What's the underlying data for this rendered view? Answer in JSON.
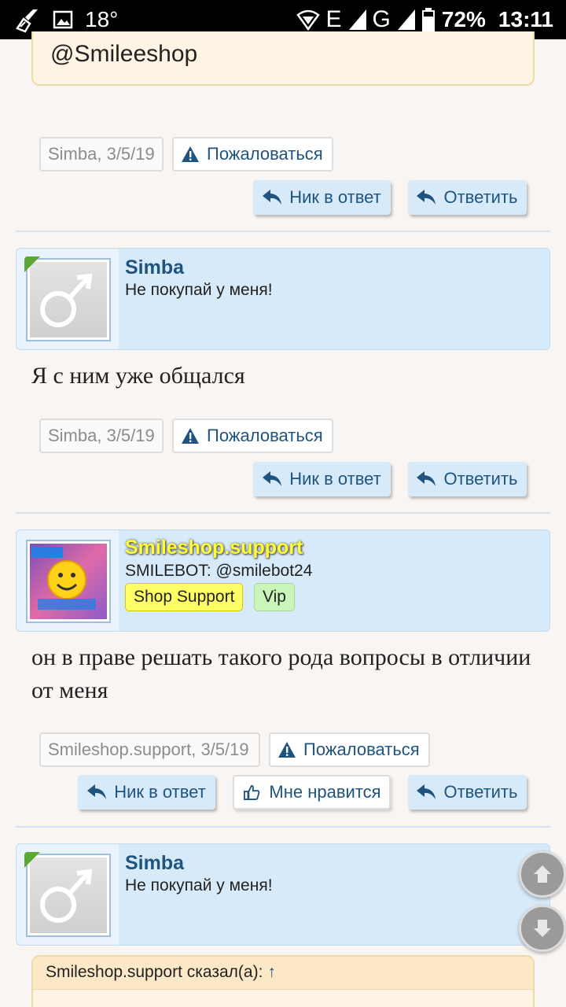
{
  "status_bar": {
    "temperature": "18°",
    "network": "E",
    "network2": "G",
    "battery": "72%",
    "time": "13:11"
  },
  "quote_top": {
    "text": "@Smileeshop"
  },
  "posts": [
    {
      "meta_author": "Simba",
      "meta_date": ", 3/5/19",
      "report_label": "Пожаловаться",
      "reply_nick_label": "Ник в ответ",
      "reply_label": "Ответить"
    },
    {
      "user_name": "Simba",
      "user_title": "Не покупай у меня!",
      "text": "Я с ним уже общался",
      "meta_author": "Simba",
      "meta_date": ", 3/5/19",
      "report_label": "Пожаловаться",
      "reply_nick_label": "Ник в ответ",
      "reply_label": "Ответить"
    },
    {
      "user_name": "Smileshop.support",
      "user_title": "SMILEBOT: @smilebot24",
      "badge1": "Shop Support",
      "badge2": "Vip",
      "text": "он в праве решать такого рода вопросы в отличии от меня",
      "meta_author": "Smileshop.support",
      "meta_date": ", 3/5/19",
      "report_label": "Пожаловаться",
      "reply_nick_label": "Ник в ответ",
      "like_label": "Мне нравится",
      "reply_label": "Ответить"
    },
    {
      "user_name": "Simba",
      "user_title": "Не покупай у меня!",
      "quote_header": "Smileshop.support сказал(а):",
      "quote_arrow": "↑"
    }
  ],
  "colors": {
    "accent": "#1f5480",
    "header_bg": "#d7eaf9",
    "quote_bg": "#fff4e3"
  },
  "icons": [
    "broom-icon",
    "image-icon",
    "wifi-icon",
    "signal-icon",
    "battery-icon",
    "warning-icon",
    "reply-icon",
    "thumbs-up-icon",
    "male-avatar-icon",
    "arrow-up-icon",
    "arrow-down-icon"
  ]
}
